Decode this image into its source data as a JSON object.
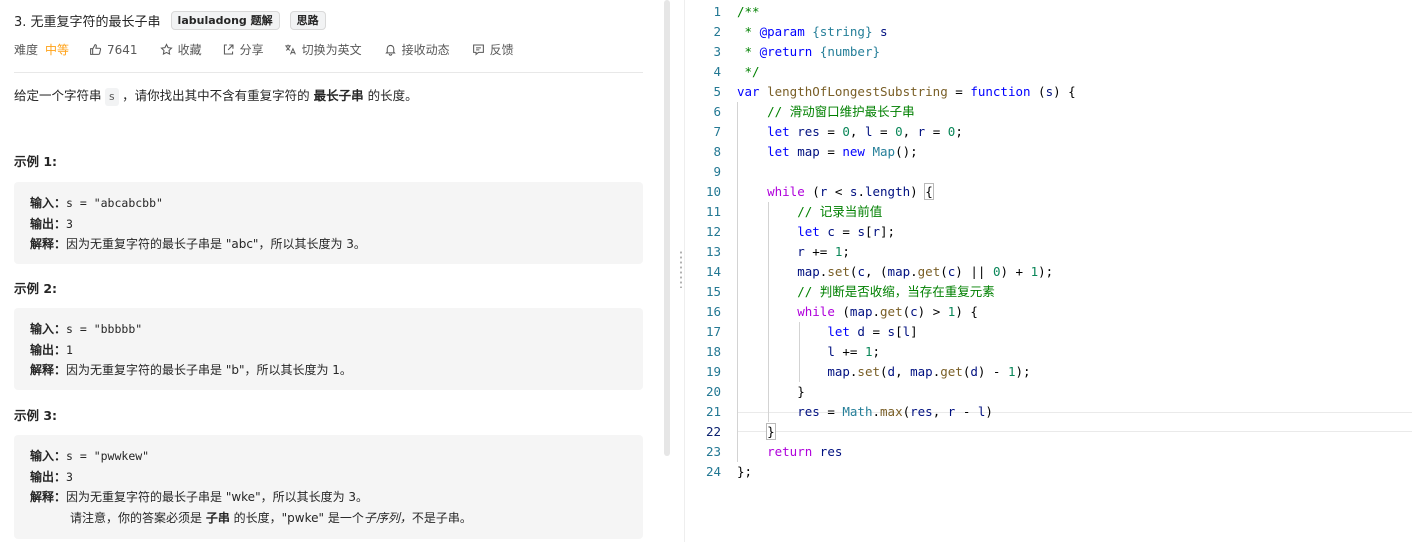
{
  "problem": {
    "title": "3. 无重复字符的最长子串",
    "tags": [
      "labuladong 题解",
      "思路"
    ],
    "meta": {
      "difficulty_label": "难度",
      "difficulty": "中等",
      "likes": "7641",
      "favorite": "收藏",
      "share": "分享",
      "switch_lang": "切换为英文",
      "subscribe": "接收动态",
      "feedback": "反馈"
    },
    "description": {
      "before": "给定一个字符串",
      "var": "s",
      "middle": "，请你找出其中不含有重复字符的",
      "bold": "最长子串",
      "after": "的长度。"
    },
    "examples": [
      {
        "title": "示例 1:",
        "input_label": "输入：",
        "input": "s = \"abcabcbb\"",
        "output_label": "输出：",
        "output": "3",
        "explain_label": "解释：",
        "explain": "因为无重复字符的最长子串是 \"abc\"，所以其长度为 3。"
      },
      {
        "title": "示例 2:",
        "input_label": "输入：",
        "input": "s = \"bbbbb\"",
        "output_label": "输出：",
        "output": "1",
        "explain_label": "解释：",
        "explain": "因为无重复字符的最长子串是 \"b\"，所以其长度为 1。"
      },
      {
        "title": "示例 3:",
        "input_label": "输入：",
        "input": "s = \"pwwkew\"",
        "output_label": "输出：",
        "output": "3",
        "explain_label": "解释：",
        "explain": "因为无重复字符的最长子串是 \"wke\"，所以其长度为 3。",
        "note_a": "请注意，你的答案必须是 ",
        "note_bold": "子串",
        "note_b": " 的长度，\"pwke\" 是一个",
        "note_italic": "子序列，",
        "note_c": "不是子串。"
      }
    ]
  },
  "editor": {
    "line_numbers": [
      "1",
      "2",
      "3",
      "4",
      "5",
      "6",
      "7",
      "8",
      "9",
      "10",
      "11",
      "12",
      "13",
      "14",
      "15",
      "16",
      "17",
      "18",
      "19",
      "20",
      "21",
      "22",
      "23",
      "24"
    ],
    "current_line": "22",
    "lines": [
      [
        {
          "t": "/**",
          "c": "c"
        }
      ],
      [
        {
          "t": " * ",
          "c": "c"
        },
        {
          "t": "@param",
          "c": "doc"
        },
        {
          "t": " {string}",
          "c": "t"
        },
        {
          "t": " s",
          "c": "v"
        }
      ],
      [
        {
          "t": " * ",
          "c": "c"
        },
        {
          "t": "@return",
          "c": "doc"
        },
        {
          "t": " {number}",
          "c": "t"
        }
      ],
      [
        {
          "t": " */",
          "c": "c"
        }
      ],
      [
        {
          "t": "var",
          "c": "k"
        },
        {
          "t": " "
        },
        {
          "t": "lengthOfLongestSubstring",
          "c": "fn"
        },
        {
          "t": " = "
        },
        {
          "t": "function",
          "c": "k"
        },
        {
          "t": " ("
        },
        {
          "t": "s",
          "c": "v"
        },
        {
          "t": ") {"
        }
      ],
      [
        {
          "t": "    "
        },
        {
          "t": "// 滑动窗口维护最长子串",
          "c": "c"
        }
      ],
      [
        {
          "t": "    "
        },
        {
          "t": "let",
          "c": "k"
        },
        {
          "t": " "
        },
        {
          "t": "res",
          "c": "v"
        },
        {
          "t": " = "
        },
        {
          "t": "0",
          "c": "n"
        },
        {
          "t": ", "
        },
        {
          "t": "l",
          "c": "v"
        },
        {
          "t": " = "
        },
        {
          "t": "0",
          "c": "n"
        },
        {
          "t": ", "
        },
        {
          "t": "r",
          "c": "v"
        },
        {
          "t": " = "
        },
        {
          "t": "0",
          "c": "n"
        },
        {
          "t": ";"
        }
      ],
      [
        {
          "t": "    "
        },
        {
          "t": "let",
          "c": "k"
        },
        {
          "t": " "
        },
        {
          "t": "map",
          "c": "v"
        },
        {
          "t": " = "
        },
        {
          "t": "new",
          "c": "k"
        },
        {
          "t": " "
        },
        {
          "t": "Map",
          "c": "t"
        },
        {
          "t": "();"
        }
      ],
      [
        {
          "t": ""
        }
      ],
      [
        {
          "t": "    "
        },
        {
          "t": "while",
          "c": "kp"
        },
        {
          "t": " ("
        },
        {
          "t": "r",
          "c": "v"
        },
        {
          "t": " < "
        },
        {
          "t": "s",
          "c": "v"
        },
        {
          "t": "."
        },
        {
          "t": "length",
          "c": "v"
        },
        {
          "t": ") "
        },
        {
          "t": "{",
          "c": "bm"
        }
      ],
      [
        {
          "t": "        "
        },
        {
          "t": "// 记录当前值",
          "c": "c"
        }
      ],
      [
        {
          "t": "        "
        },
        {
          "t": "let",
          "c": "k"
        },
        {
          "t": " "
        },
        {
          "t": "c",
          "c": "v"
        },
        {
          "t": " = "
        },
        {
          "t": "s",
          "c": "v"
        },
        {
          "t": "["
        },
        {
          "t": "r",
          "c": "v"
        },
        {
          "t": "];"
        }
      ],
      [
        {
          "t": "        "
        },
        {
          "t": "r",
          "c": "v"
        },
        {
          "t": " += "
        },
        {
          "t": "1",
          "c": "n"
        },
        {
          "t": ";"
        }
      ],
      [
        {
          "t": "        "
        },
        {
          "t": "map",
          "c": "v"
        },
        {
          "t": "."
        },
        {
          "t": "set",
          "c": "fn"
        },
        {
          "t": "("
        },
        {
          "t": "c",
          "c": "v"
        },
        {
          "t": ", ("
        },
        {
          "t": "map",
          "c": "v"
        },
        {
          "t": "."
        },
        {
          "t": "get",
          "c": "fn"
        },
        {
          "t": "("
        },
        {
          "t": "c",
          "c": "v"
        },
        {
          "t": ") || "
        },
        {
          "t": "0",
          "c": "n"
        },
        {
          "t": ") + "
        },
        {
          "t": "1",
          "c": "n"
        },
        {
          "t": ");"
        }
      ],
      [
        {
          "t": "        "
        },
        {
          "t": "// 判断是否收缩，当存在重复元素",
          "c": "c"
        }
      ],
      [
        {
          "t": "        "
        },
        {
          "t": "while",
          "c": "kp"
        },
        {
          "t": " ("
        },
        {
          "t": "map",
          "c": "v"
        },
        {
          "t": "."
        },
        {
          "t": "get",
          "c": "fn"
        },
        {
          "t": "("
        },
        {
          "t": "c",
          "c": "v"
        },
        {
          "t": ") > "
        },
        {
          "t": "1",
          "c": "n"
        },
        {
          "t": ") {"
        }
      ],
      [
        {
          "t": "            "
        },
        {
          "t": "let",
          "c": "k"
        },
        {
          "t": " "
        },
        {
          "t": "d",
          "c": "v"
        },
        {
          "t": " = "
        },
        {
          "t": "s",
          "c": "v"
        },
        {
          "t": "["
        },
        {
          "t": "l",
          "c": "v"
        },
        {
          "t": "]"
        }
      ],
      [
        {
          "t": "            "
        },
        {
          "t": "l",
          "c": "v"
        },
        {
          "t": " += "
        },
        {
          "t": "1",
          "c": "n"
        },
        {
          "t": ";"
        }
      ],
      [
        {
          "t": "            "
        },
        {
          "t": "map",
          "c": "v"
        },
        {
          "t": "."
        },
        {
          "t": "set",
          "c": "fn"
        },
        {
          "t": "("
        },
        {
          "t": "d",
          "c": "v"
        },
        {
          "t": ", "
        },
        {
          "t": "map",
          "c": "v"
        },
        {
          "t": "."
        },
        {
          "t": "get",
          "c": "fn"
        },
        {
          "t": "("
        },
        {
          "t": "d",
          "c": "v"
        },
        {
          "t": ") - "
        },
        {
          "t": "1",
          "c": "n"
        },
        {
          "t": ");"
        }
      ],
      [
        {
          "t": "        }"
        }
      ],
      [
        {
          "t": "        "
        },
        {
          "t": "res",
          "c": "v"
        },
        {
          "t": " = "
        },
        {
          "t": "Math",
          "c": "t"
        },
        {
          "t": "."
        },
        {
          "t": "max",
          "c": "fn"
        },
        {
          "t": "("
        },
        {
          "t": "res",
          "c": "v"
        },
        {
          "t": ", "
        },
        {
          "t": "r",
          "c": "v"
        },
        {
          "t": " - "
        },
        {
          "t": "l",
          "c": "v"
        },
        {
          "t": ")"
        }
      ],
      [
        {
          "t": "    "
        },
        {
          "t": "}",
          "c": "bm"
        }
      ],
      [
        {
          "t": "    "
        },
        {
          "t": "return",
          "c": "kp"
        },
        {
          "t": " "
        },
        {
          "t": "res",
          "c": "v"
        }
      ],
      [
        {
          "t": "};"
        }
      ]
    ]
  },
  "colors": {
    "difficulty_medium": "#ffa116",
    "line_number": "#237893",
    "comment": "#008000",
    "keyword": "#0000ff",
    "control_keyword": "#af00db",
    "function": "#795e26",
    "variable": "#001080",
    "number": "#098658",
    "type": "#267f99"
  },
  "icons": [
    "thumbs-up-icon",
    "star-icon",
    "share-icon",
    "translate-icon",
    "bell-icon",
    "feedback-icon"
  ]
}
